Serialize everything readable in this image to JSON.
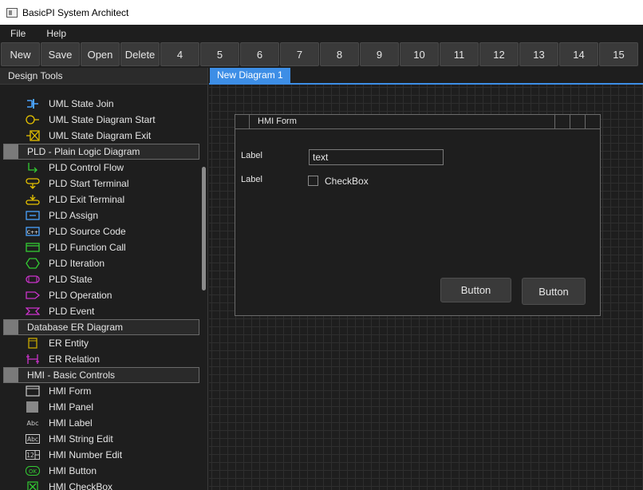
{
  "window": {
    "title": "BasicPI System Architect"
  },
  "menu": {
    "items": [
      "File",
      "Help"
    ]
  },
  "toolbar": {
    "buttons": [
      "New",
      "Save",
      "Open",
      "Delete",
      "4",
      "5",
      "6",
      "7",
      "8",
      "9",
      "10",
      "11",
      "12",
      "13",
      "14",
      "15"
    ]
  },
  "left_panel": {
    "title": "Design Tools",
    "items": [
      {
        "kind": "item",
        "label": "UML State Join",
        "icon": "uml-state-join-icon",
        "color": "#4aa3ff"
      },
      {
        "kind": "item",
        "label": "UML State Diagram Start",
        "icon": "uml-state-start-icon",
        "color": "#e6c200"
      },
      {
        "kind": "item",
        "label": "UML State Diagram Exit",
        "icon": "uml-state-exit-icon",
        "color": "#e6c200"
      },
      {
        "kind": "group",
        "label": "PLD - Plain Logic Diagram"
      },
      {
        "kind": "item",
        "label": "PLD Control Flow",
        "icon": "pld-control-flow-icon",
        "color": "#33cc33"
      },
      {
        "kind": "item",
        "label": "PLD Start Terminal",
        "icon": "pld-start-terminal-icon",
        "color": "#e6c200"
      },
      {
        "kind": "item",
        "label": "PLD Exit Terminal",
        "icon": "pld-exit-terminal-icon",
        "color": "#e6c200"
      },
      {
        "kind": "item",
        "label": "PLD Assign",
        "icon": "pld-assign-icon",
        "color": "#4aa3ff"
      },
      {
        "kind": "item",
        "label": "PLD Source Code",
        "icon": "pld-source-code-icon",
        "color": "#4aa3ff"
      },
      {
        "kind": "item",
        "label": "PLD Function Call",
        "icon": "pld-function-call-icon",
        "color": "#33cc33"
      },
      {
        "kind": "item",
        "label": "PLD Iteration",
        "icon": "pld-iteration-icon",
        "color": "#33cc33"
      },
      {
        "kind": "item",
        "label": "PLD State",
        "icon": "pld-state-icon",
        "color": "#cc33cc"
      },
      {
        "kind": "item",
        "label": "PLD Operation",
        "icon": "pld-operation-icon",
        "color": "#cc33cc"
      },
      {
        "kind": "item",
        "label": "PLD Event",
        "icon": "pld-event-icon",
        "color": "#cc33cc"
      },
      {
        "kind": "group",
        "label": "Database ER Diagram"
      },
      {
        "kind": "item",
        "label": "ER Entity",
        "icon": "er-entity-icon",
        "color": "#c8a800"
      },
      {
        "kind": "item",
        "label": "ER Relation",
        "icon": "er-relation-icon",
        "color": "#cc33cc"
      },
      {
        "kind": "group",
        "label": "HMI - Basic Controls"
      },
      {
        "kind": "item",
        "label": "HMI Form",
        "icon": "hmi-form-icon",
        "color": "#cccccc"
      },
      {
        "kind": "item",
        "label": "HMI Panel",
        "icon": "hmi-panel-icon",
        "color": "#888888"
      },
      {
        "kind": "item",
        "label": "HMI Label",
        "icon": "hmi-label-icon",
        "color": "#cccccc",
        "glyph": "Abc"
      },
      {
        "kind": "item",
        "label": "HMI String Edit",
        "icon": "hmi-string-edit-icon",
        "color": "#cccccc",
        "glyph": "Abc"
      },
      {
        "kind": "item",
        "label": "HMI Number Edit",
        "icon": "hmi-number-edit-icon",
        "color": "#cccccc",
        "glyph": "12"
      },
      {
        "kind": "item",
        "label": "HMI Button",
        "icon": "hmi-button-icon",
        "color": "#33cc33",
        "glyph": "OK"
      },
      {
        "kind": "item",
        "label": "HMI CheckBox",
        "icon": "hmi-checkbox-icon",
        "color": "#33cc33"
      }
    ]
  },
  "tabs": [
    {
      "label": "New Diagram 1",
      "active": true
    }
  ],
  "hmi_form": {
    "title": "HMI Form",
    "label1": "Label",
    "label2": "Label",
    "text_value": "text",
    "checkbox_label": "CheckBox",
    "checkbox_checked": false,
    "button1": "Button",
    "button2": "Button"
  },
  "colors": {
    "accent": "#3d8ee6",
    "background": "#1e1e1e",
    "button": "#3a3a3a"
  }
}
